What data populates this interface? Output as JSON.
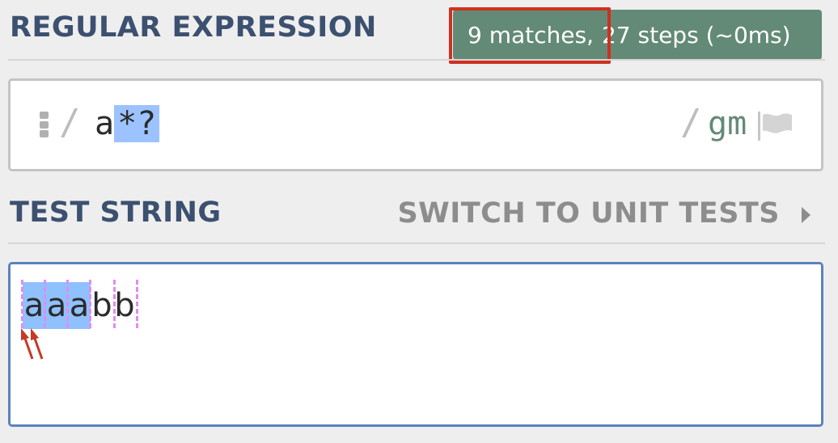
{
  "regex_section": {
    "title": "REGULAR EXPRESSION",
    "match_count": "9 matches,",
    "match_steps": "27 steps (~0ms)",
    "open_delimiter": "/",
    "pattern_base": "a",
    "pattern_quantifier": "*?",
    "close_delimiter": "/",
    "flags": "gm",
    "flag_icon": "flag-icon",
    "handle_icon": "drag-handle-icon"
  },
  "test_section": {
    "title": "TEST STRING",
    "switch_label": "SWITCH TO UNIT TESTS",
    "switch_icon": "caret-right-icon",
    "chars": [
      "a",
      "a",
      "a",
      "b",
      "b"
    ],
    "annotation_icon": "double-arrow-icon"
  },
  "colors": {
    "header_text": "#3c5070",
    "match_badge": "#638a77",
    "highlight_border": "#d0301f",
    "match_fill": "#8fc1ff",
    "empty_match_marker": "#e38bf0",
    "test_border": "#5b82c0"
  }
}
